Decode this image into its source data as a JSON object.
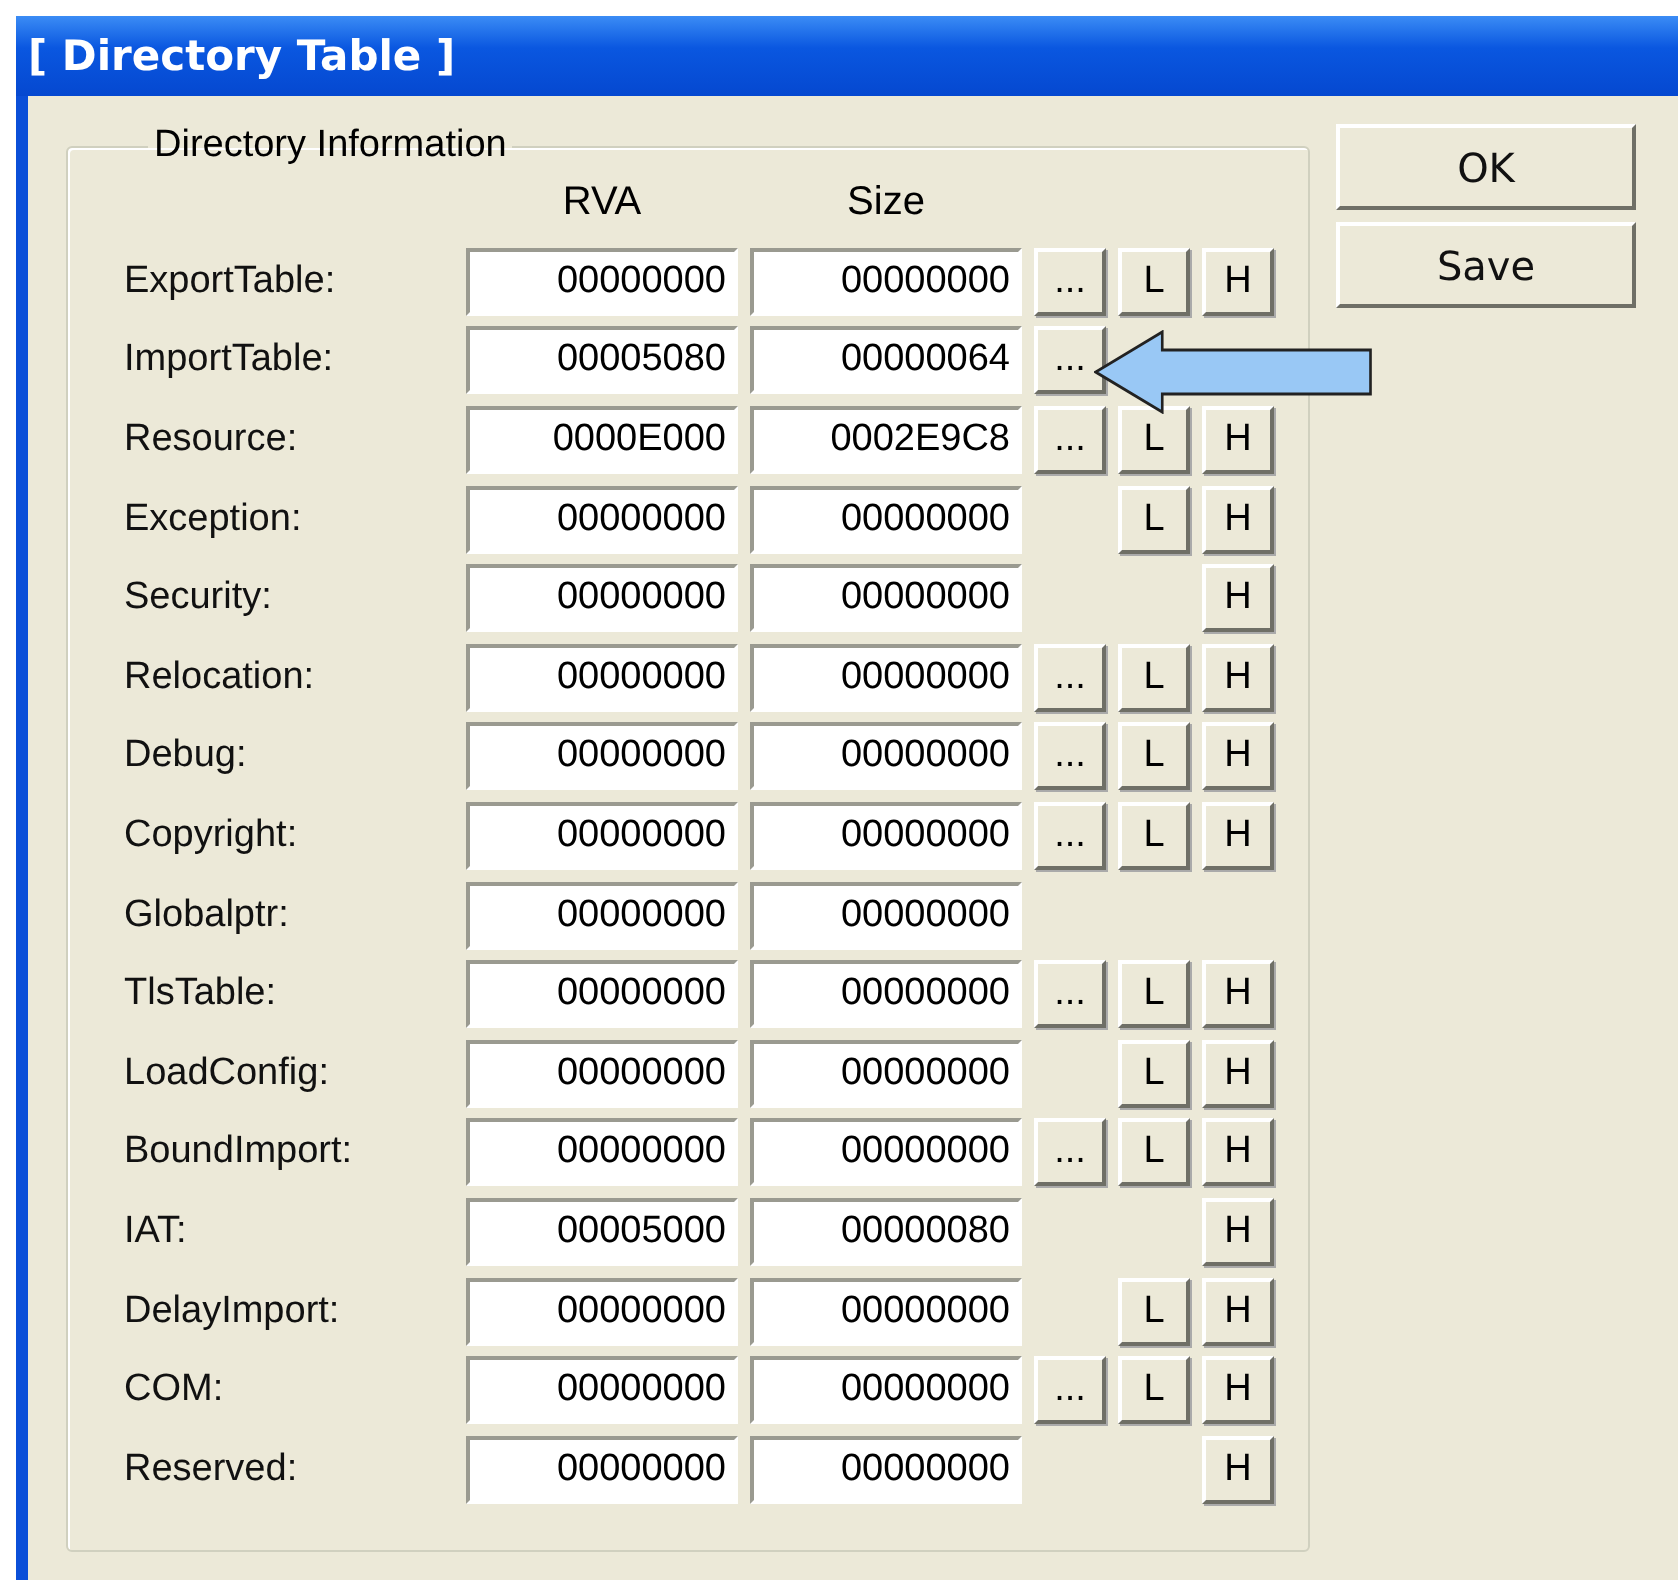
{
  "window": {
    "title": "[ Directory Table ]"
  },
  "group": {
    "title": "Directory Information",
    "columns": [
      "RVA",
      "Size"
    ]
  },
  "rows": [
    {
      "label": "ExportTable:",
      "rva": "00000000",
      "size": "00000000",
      "buttons": [
        {
          "kind": "view",
          "label": "..."
        },
        {
          "kind": "l",
          "label": "L"
        },
        {
          "kind": "h",
          "label": "H"
        }
      ]
    },
    {
      "label": "ImportTable:",
      "rva": "00005080",
      "size": "00000064",
      "buttons": [
        {
          "kind": "view",
          "label": "..."
        }
      ]
    },
    {
      "label": "Resource:",
      "rva": "0000E000",
      "size": "0002E9C8",
      "buttons": [
        {
          "kind": "view",
          "label": "..."
        },
        {
          "kind": "l",
          "label": "L"
        },
        {
          "kind": "h",
          "label": "H"
        }
      ]
    },
    {
      "label": "Exception:",
      "rva": "00000000",
      "size": "00000000",
      "buttons": [
        {
          "kind": "l",
          "label": "L"
        },
        {
          "kind": "h",
          "label": "H"
        }
      ]
    },
    {
      "label": "Security:",
      "rva": "00000000",
      "size": "00000000",
      "buttons": [
        {
          "kind": "h",
          "label": "H"
        }
      ]
    },
    {
      "label": "Relocation:",
      "rva": "00000000",
      "size": "00000000",
      "buttons": [
        {
          "kind": "view",
          "label": "..."
        },
        {
          "kind": "l",
          "label": "L"
        },
        {
          "kind": "h",
          "label": "H"
        }
      ]
    },
    {
      "label": "Debug:",
      "rva": "00000000",
      "size": "00000000",
      "buttons": [
        {
          "kind": "view",
          "label": "..."
        },
        {
          "kind": "l",
          "label": "L"
        },
        {
          "kind": "h",
          "label": "H"
        }
      ]
    },
    {
      "label": "Copyright:",
      "rva": "00000000",
      "size": "00000000",
      "buttons": [
        {
          "kind": "view",
          "label": "..."
        },
        {
          "kind": "l",
          "label": "L"
        },
        {
          "kind": "h",
          "label": "H"
        }
      ]
    },
    {
      "label": "Globalptr:",
      "rva": "00000000",
      "size": "00000000",
      "buttons": []
    },
    {
      "label": "TlsTable:",
      "rva": "00000000",
      "size": "00000000",
      "buttons": [
        {
          "kind": "view",
          "label": "..."
        },
        {
          "kind": "l",
          "label": "L"
        },
        {
          "kind": "h",
          "label": "H"
        }
      ]
    },
    {
      "label": "LoadConfig:",
      "rva": "00000000",
      "size": "00000000",
      "buttons": [
        {
          "kind": "l",
          "label": "L"
        },
        {
          "kind": "h",
          "label": "H"
        }
      ]
    },
    {
      "label": "BoundImport:",
      "rva": "00000000",
      "size": "00000000",
      "buttons": [
        {
          "kind": "view",
          "label": "..."
        },
        {
          "kind": "l",
          "label": "L"
        },
        {
          "kind": "h",
          "label": "H"
        }
      ]
    },
    {
      "label": "IAT:",
      "rva": "00005000",
      "size": "00000080",
      "buttons": [
        {
          "kind": "h",
          "label": "H"
        }
      ]
    },
    {
      "label": "DelayImport:",
      "rva": "00000000",
      "size": "00000000",
      "buttons": [
        {
          "kind": "l",
          "label": "L"
        },
        {
          "kind": "h",
          "label": "H"
        }
      ]
    },
    {
      "label": "COM:",
      "rva": "00000000",
      "size": "00000000",
      "buttons": [
        {
          "kind": "view",
          "label": "..."
        },
        {
          "kind": "l",
          "label": "L"
        },
        {
          "kind": "h",
          "label": "H"
        }
      ]
    },
    {
      "label": "Reserved:",
      "rva": "00000000",
      "size": "00000000",
      "buttons": [
        {
          "kind": "h",
          "label": "H"
        }
      ]
    }
  ],
  "actions": [
    "OK",
    "Save"
  ]
}
